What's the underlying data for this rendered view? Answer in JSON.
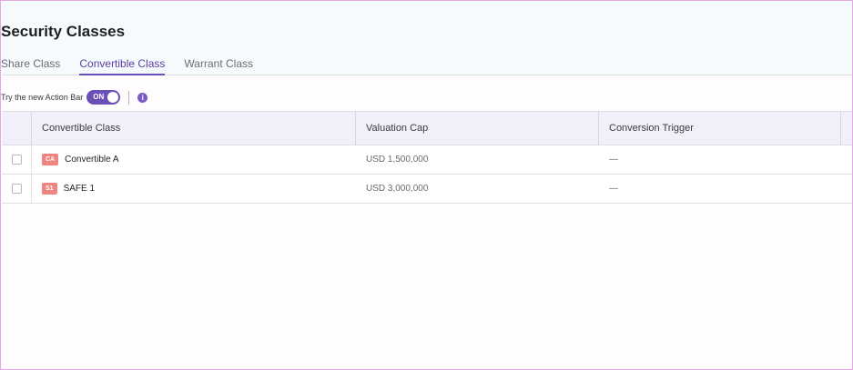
{
  "page": {
    "title": "Security Classes"
  },
  "tabs": [
    {
      "label": "Share Class",
      "active": false
    },
    {
      "label": "Convertible Class",
      "active": true
    },
    {
      "label": "Warrant Class",
      "active": false
    }
  ],
  "action_bar": {
    "label": "Try the new Action Bar",
    "toggle_text": "ON",
    "toggle_on": true,
    "info_glyph": "i"
  },
  "table": {
    "columns": [
      "Convertible Class",
      "Valuation Cap",
      "Conversion Trigger"
    ],
    "rows": [
      {
        "badge": "CA",
        "name": "Convertible A",
        "valuation_cap": "USD 1,500,000",
        "conversion_trigger": "—"
      },
      {
        "badge": "S1",
        "name": "SAFE 1",
        "valuation_cap": "USD 3,000,000",
        "conversion_trigger": "—"
      }
    ]
  },
  "colors": {
    "accent": "#6a4fb6",
    "badge": "#ef8580",
    "header_band": "#f5fafc",
    "table_header": "#f1eff9"
  },
  "icons": {
    "info": "info-icon",
    "toggle": "toggle-switch"
  }
}
